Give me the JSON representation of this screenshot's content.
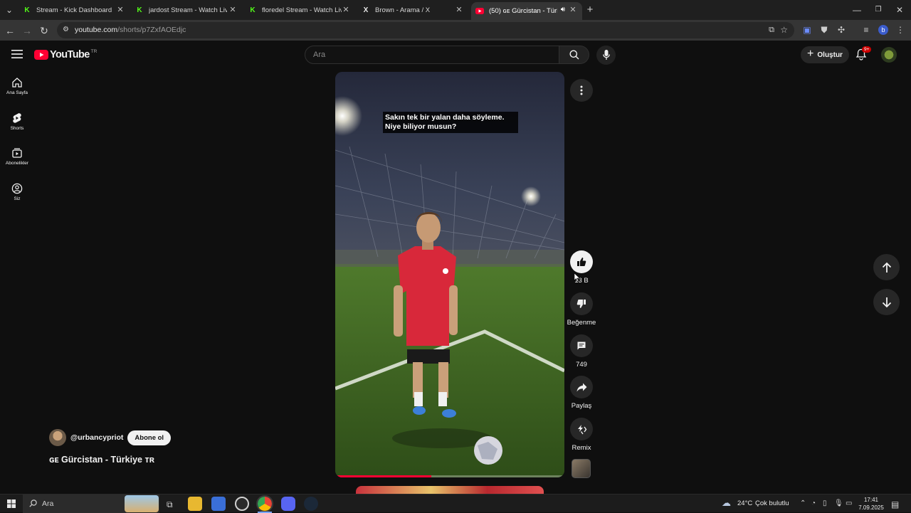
{
  "browser": {
    "tabs": [
      {
        "title": "Stream - Kick Dashboard",
        "icon": "kick-icon"
      },
      {
        "title": "jardost Stream - Watch Live on",
        "icon": "kick-icon"
      },
      {
        "title": "floredel Stream - Watch Live on",
        "icon": "kick-icon"
      },
      {
        "title": "Brown - Arama / X",
        "icon": "x-icon"
      },
      {
        "title": "(50) ɢᴇ Gürcistan - Türkiye ᴛ",
        "icon": "youtube-icon"
      }
    ],
    "url_host": "youtube.com",
    "url_path": "/shorts/p7ZxfAOEdjc",
    "profile_initial": "b"
  },
  "youtube": {
    "logo_text": "YouTube",
    "region": "TR",
    "search_placeholder": "Ara",
    "create_label": "Oluştur",
    "notif_count": "9+",
    "sidebar": [
      {
        "label": "Ana Sayfa"
      },
      {
        "label": "Shorts"
      },
      {
        "label": "Abonelikler"
      },
      {
        "label": "Siz"
      }
    ],
    "video": {
      "caption": "Sakın tek bir yalan daha söyleme. Niye biliyor musun?",
      "progress": 0.42
    },
    "actions": {
      "likes": "13 B",
      "dislike_label": "Beğenme",
      "comments": "749",
      "share_label": "Paylaş",
      "remix_label": "Remix"
    },
    "channel": {
      "handle": "@urbancypriot",
      "subscribe_label": "Abone ol"
    },
    "title": "ɢᴇ Gürcistan - Türkiye ᴛʀ"
  },
  "taskbar": {
    "search_placeholder": "Ara",
    "temperature": "24°C",
    "weather": "Çok bulutlu",
    "time": "17:41",
    "date": "7.09.2025"
  }
}
